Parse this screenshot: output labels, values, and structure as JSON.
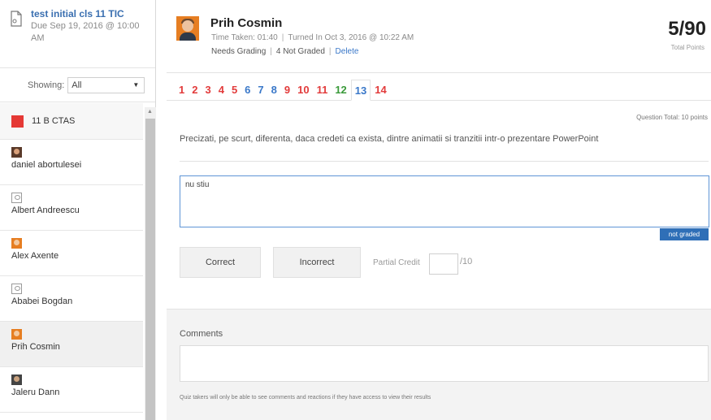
{
  "quiz": {
    "title": "test initial cls 11 TIC",
    "due": "Due Sep 19, 2016 @ 10:00 AM"
  },
  "filter": {
    "label": "Showing:",
    "value": "All"
  },
  "group": {
    "label": "11 B CTAS",
    "color": "#e53935"
  },
  "students": [
    {
      "name": "daniel abortulesei",
      "avatar": "photo-dark"
    },
    {
      "name": "Albert Andreescu",
      "avatar": "placeholder"
    },
    {
      "name": "Alex Axente",
      "avatar": "photo-orange"
    },
    {
      "name": "Ababei Bogdan",
      "avatar": "placeholder"
    },
    {
      "name": "Prih Cosmin",
      "avatar": "photo-orange",
      "active": true
    },
    {
      "name": "Jaleru Dann",
      "avatar": "photo-dark"
    }
  ],
  "submission": {
    "student_name": "Prih Cosmin",
    "time_taken_label": "Time Taken: 01:40",
    "turned_in_label": "Turned In Oct 3, 2016 @ 10:22 AM",
    "status": "Needs Grading",
    "not_graded": "4 Not Graded",
    "delete_label": "Delete",
    "score": "5/90",
    "score_label": "Total Points"
  },
  "question_tabs": [
    {
      "label": "1",
      "state": "incorrect"
    },
    {
      "label": "2",
      "state": "incorrect"
    },
    {
      "label": "3",
      "state": "incorrect"
    },
    {
      "label": "4",
      "state": "incorrect"
    },
    {
      "label": "5",
      "state": "incorrect"
    },
    {
      "label": "6",
      "state": "ungraded"
    },
    {
      "label": "7",
      "state": "ungraded"
    },
    {
      "label": "8",
      "state": "ungraded"
    },
    {
      "label": "9",
      "state": "incorrect"
    },
    {
      "label": "10",
      "state": "incorrect"
    },
    {
      "label": "11",
      "state": "incorrect"
    },
    {
      "label": "12",
      "state": "correct"
    },
    {
      "label": "13",
      "state": "active"
    },
    {
      "label": "14",
      "state": "incorrect"
    }
  ],
  "question": {
    "total": "Question Total: 10 points",
    "text": "Precizati, pe scurt, diferenta, daca credeti ca exista, dintre animatii si tranzitii intr-o prezentare PowerPoint",
    "answer": "nu stiu",
    "badge": "not graded"
  },
  "grading": {
    "correct_label": "Correct",
    "incorrect_label": "Incorrect",
    "partial_label": "Partial Credit",
    "partial_value": "",
    "partial_max": "/10"
  },
  "comments": {
    "label": "Comments",
    "value": "",
    "note": "Quiz takers will only be able to see comments and reactions if they have access to view their results"
  },
  "colors": {
    "accent": "#3a78c9",
    "incorrect": "#e23b3b",
    "correct": "#3a9a3a",
    "badge": "#2f6fb7"
  }
}
